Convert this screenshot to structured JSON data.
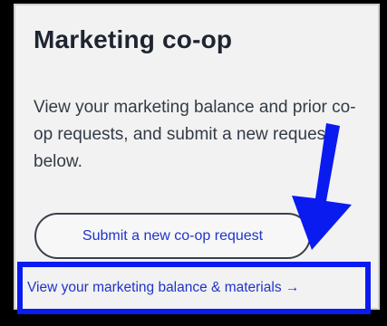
{
  "card": {
    "title": "Marketing co-op",
    "description": "View your marketing balance and prior co-op requests, and submit a new request below.",
    "submit_button_label": "Submit a new co-op request",
    "balance_link_label": "View your marketing balance & materials →"
  },
  "annotation": {
    "arrow_color": "#0a1bf0",
    "highlight_color": "#0a1bf0",
    "arrow_icon": "arrow-down-icon"
  }
}
